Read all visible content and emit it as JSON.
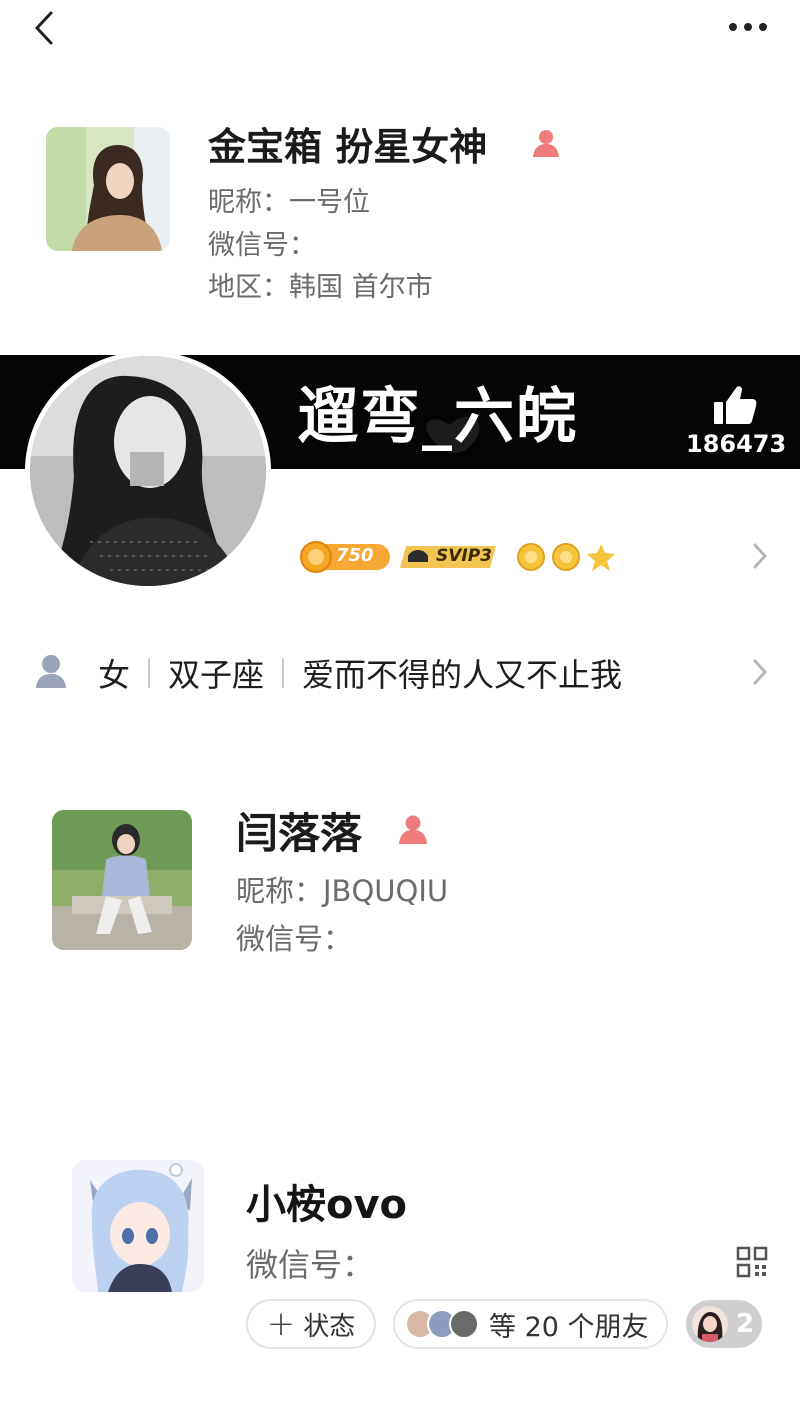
{
  "nav": {
    "back_icon": "chevron-left-icon",
    "more_icon": "ellipsis-icon"
  },
  "profile1": {
    "name": "金宝箱 扮星女神",
    "gender_icon": "female-person-icon",
    "nickname": "昵称：一号位",
    "wechat_id": "微信号：",
    "region": "地区：韩国 首尔市"
  },
  "profile2": {
    "name": "遛弯_六皖",
    "likes": "186473",
    "coins": "750",
    "vip": "SVIP3",
    "gender": "女",
    "zodiac": "双子座",
    "signature": "爱而不得的人又不止我"
  },
  "profile3": {
    "name": "闫落落",
    "gender_icon": "female-person-icon",
    "nickname": "昵称：JBQUQIU",
    "wechat_id": "微信号："
  },
  "profile4": {
    "name": "小桉ovo",
    "wechat_id": "微信号：",
    "status_button": "状态",
    "friends_text": "等 20 个朋友",
    "count": "2"
  },
  "colors": {
    "female_icon": "#f07b7b",
    "banner": "#050505",
    "coin": "#f5a623",
    "vip_bg": "#f3c453",
    "star": "#f6c43a"
  }
}
